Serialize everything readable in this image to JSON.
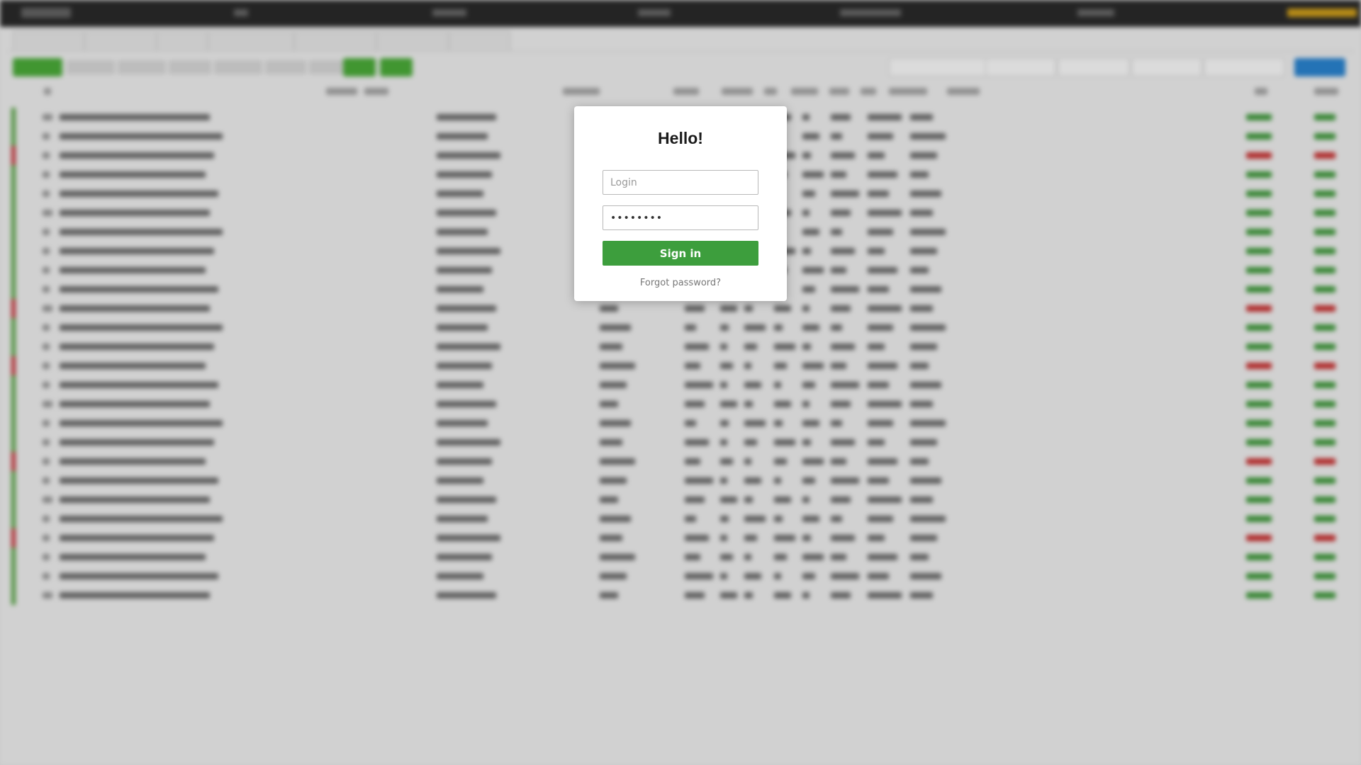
{
  "modal": {
    "title": "Hello!",
    "login_placeholder": "Login",
    "password_value": "••••••••",
    "signin_label": "Sign in",
    "forgot_label": "Forgot password?"
  },
  "colors": {
    "signin_button": "#3d9e3d",
    "status_positive": "#58a845",
    "status_negative": "#c8353a",
    "accent_blue": "#2a86d4",
    "account_badge": "#d4a21b"
  },
  "background": {
    "row_statuses": [
      "pos",
      "pos",
      "neg",
      "pos",
      "pos",
      "pos",
      "pos",
      "pos",
      "pos",
      "pos",
      "neg",
      "pos",
      "pos",
      "neg",
      "pos",
      "pos",
      "pos",
      "pos",
      "neg",
      "pos",
      "pos",
      "pos",
      "neg",
      "pos",
      "pos",
      "pos"
    ]
  }
}
